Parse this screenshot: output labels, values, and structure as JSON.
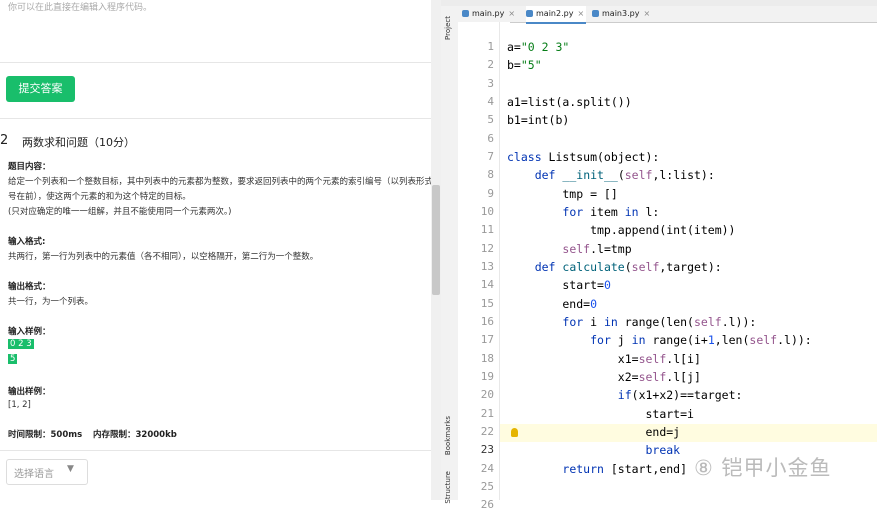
{
  "left": {
    "top_text": "你可以在此直接在编辑入程序代码。",
    "submit_label": "提交答案",
    "question_number": "2",
    "question_title": "两数求和问题（10分）",
    "content_label": "题目内容：",
    "content_lines": [
      "给定一个列表和一个整数目标，其中列表中的元素都为整数，要求返回列表中的两个元素的索引编号（以列表形式打",
      "号在前），使这两个元素的和为这个特定的目标。",
      "(只对应确定的唯一一组解，并且不能使用同一个元素两次。)"
    ],
    "input_format_label": "输入格式:",
    "input_format_text": "共两行，第一行为列表中的元素值（各不相同），以空格隔开，第二行为一个整数。",
    "output_format_label": "输出格式：",
    "output_format_text": "共一行，为一个列表。",
    "input_sample_label": "输入样例：",
    "input_sample_line1": "0 2 3",
    "input_sample_line2": "5",
    "output_sample_label": "输出样例：",
    "output_sample_text": "[1, 2]",
    "time_limit": "时间限制：500ms",
    "memory_limit": "内存限制：32000kb",
    "language_placeholder": "选择语言"
  },
  "ide": {
    "sidebar_labels": [
      "Project",
      "Bookmarks",
      "Structure"
    ],
    "tabs": [
      {
        "label": "main.py",
        "active": false
      },
      {
        "label": "main2.py",
        "active": true
      },
      {
        "label": "main3.py",
        "active": false
      }
    ],
    "line_numbers": [
      "1",
      "2",
      "3",
      "4",
      "5",
      "6",
      "7",
      "8",
      "9",
      "10",
      "11",
      "12",
      "13",
      "14",
      "15",
      "16",
      "17",
      "18",
      "19",
      "20",
      "21",
      "22",
      "23",
      "24",
      "25",
      "26"
    ],
    "current_line": 23
  },
  "watermark": "⑧ 铠甲小金鱼",
  "colors": {
    "accent_green": "#19be6b",
    "keyword": "#0033b3",
    "function": "#00627a",
    "self": "#94558d",
    "number": "#1750eb",
    "string": "#067d17"
  }
}
